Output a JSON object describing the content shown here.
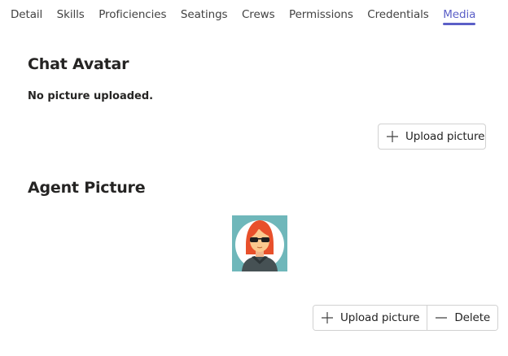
{
  "tabs": [
    {
      "label": "Detail"
    },
    {
      "label": "Skills"
    },
    {
      "label": "Proficiencies"
    },
    {
      "label": "Seatings"
    },
    {
      "label": "Crews"
    },
    {
      "label": "Permissions"
    },
    {
      "label": "Credentials"
    },
    {
      "label": "Media"
    }
  ],
  "active_tab": "Media",
  "chat_avatar": {
    "title": "Chat Avatar",
    "status": "No picture uploaded.",
    "upload_label": "Upload picture"
  },
  "agent_picture": {
    "title": "Agent Picture",
    "image_icon": "agent-avatar-sunglasses",
    "upload_label": "Upload picture",
    "delete_label": "Delete"
  },
  "colors": {
    "accent": "#5b5fc7",
    "text": "#252423",
    "border": "#d1d1d1",
    "avatar_bg": "#6fb7ba"
  }
}
